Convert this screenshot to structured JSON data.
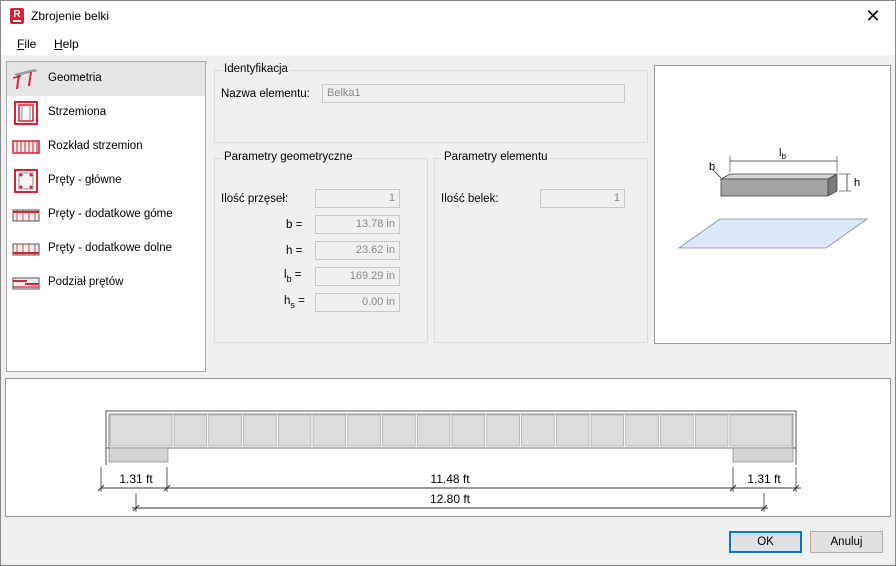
{
  "window": {
    "title": "Zbrojenie belki",
    "app_icon_letter": "R",
    "close_glyph": "✕"
  },
  "menu": {
    "file_u": "F",
    "file_rest": "ile",
    "help_u": "H",
    "help_rest": "elp"
  },
  "nav": {
    "items": [
      {
        "label": "Geometria",
        "icon": "beam-geometry-icon"
      },
      {
        "label": "Strzemiona",
        "icon": "stirrup-icon"
      },
      {
        "label": "Rozkład strzemion",
        "icon": "stirrup-distribution-icon"
      },
      {
        "label": "Pręty - główne",
        "icon": "main-bars-icon"
      },
      {
        "label": "Pręty - dodatkowe góme",
        "icon": "top-bars-icon"
      },
      {
        "label": "Pręty - dodatkowe dolne",
        "icon": "bottom-bars-icon"
      },
      {
        "label": "Podział prętów",
        "icon": "bar-split-icon"
      }
    ]
  },
  "identification": {
    "title": "Identyfikacja",
    "name_label": "Nazwa elementu:",
    "name_value": "Belka1"
  },
  "geometry": {
    "title": "Parametry geometryczne",
    "spans_label": "Ilość przęseł:",
    "spans_value": "1",
    "b_label": "b =",
    "b_value": "13.78 in",
    "h_label": "h =",
    "h_value": "23.62 in",
    "lb_main": "l",
    "lb_sub": "b",
    "lb_eq": "=",
    "lb_value": "169.29 in",
    "hs_main": "h",
    "hs_sub": "s",
    "hs_eq": "=",
    "hs_value": "0.00 in"
  },
  "element_params": {
    "title": "Parametry elementu",
    "count_label": "Ilość belek:",
    "count_value": "1"
  },
  "preview": {
    "lb_main": "l",
    "lb_sub": "b",
    "b": "b",
    "h": "h"
  },
  "elevation": {
    "left_support": "1.31 ft",
    "clear_span": "11.48 ft",
    "right_support": "1.31 ft",
    "total": "12.80 ft",
    "segments": 18
  },
  "buttons": {
    "ok": "OK",
    "cancel": "Anuluj"
  },
  "colors": {
    "accent_red": "#d42332",
    "focus_blue": "#0078d7",
    "slab_fill": "#dce9fb"
  }
}
